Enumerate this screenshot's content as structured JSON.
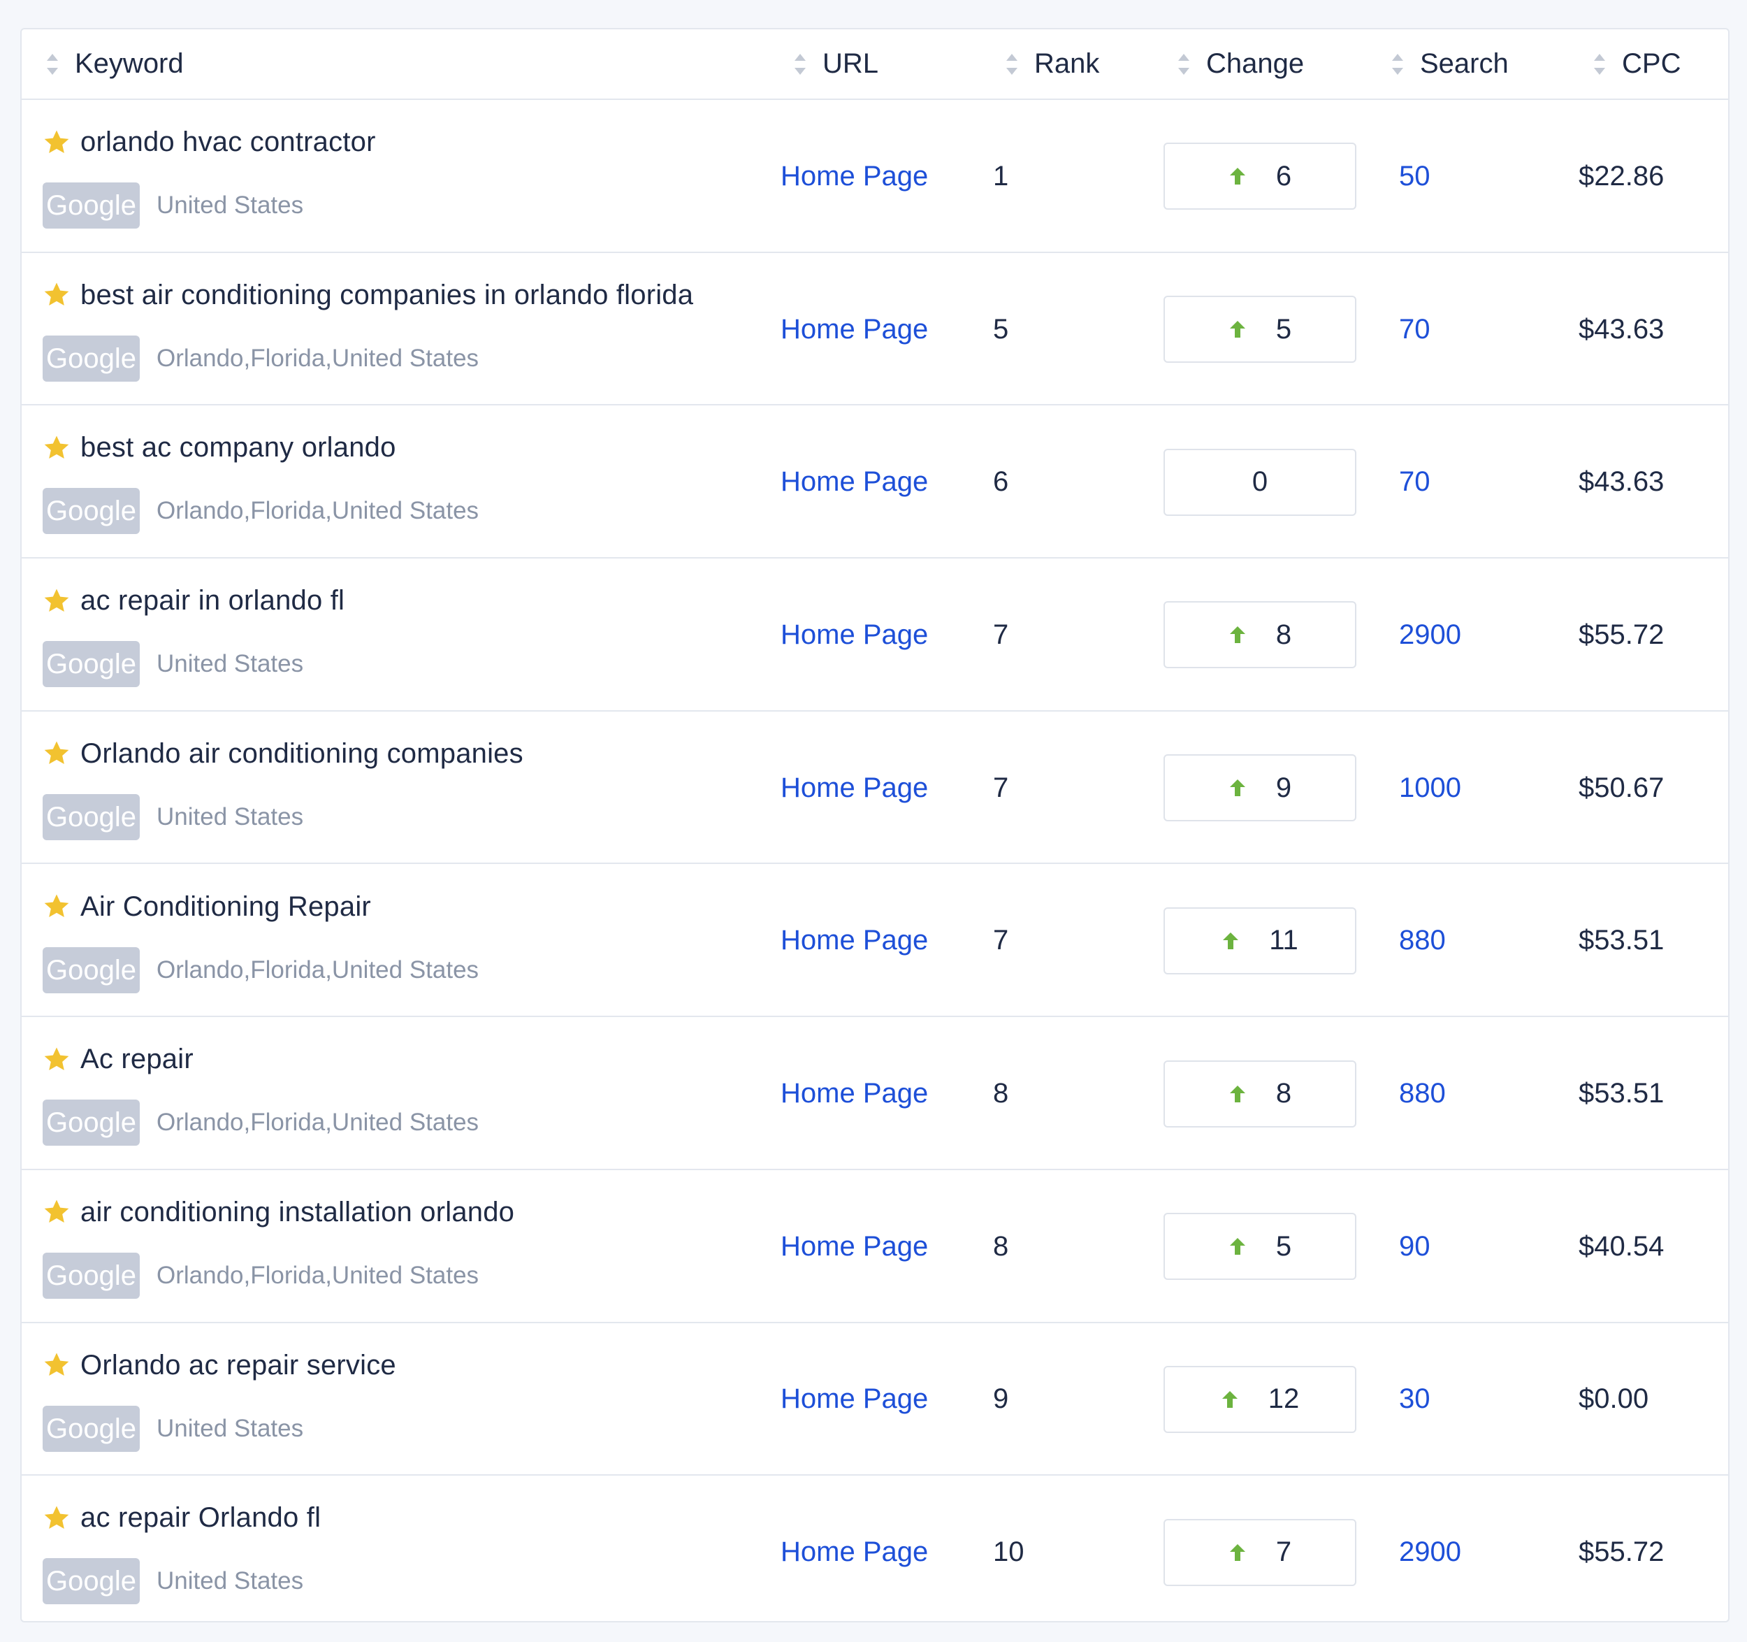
{
  "table": {
    "columns": [
      {
        "key": "keyword",
        "label": "Keyword"
      },
      {
        "key": "url",
        "label": "URL"
      },
      {
        "key": "rank",
        "label": "Rank"
      },
      {
        "key": "change",
        "label": "Change"
      },
      {
        "key": "search",
        "label": "Search"
      },
      {
        "key": "cpc",
        "label": "CPC"
      }
    ],
    "rows": [
      {
        "keyword": "orlando hvac contractor",
        "engine": "Google",
        "location": "United States",
        "url": "Home Page",
        "rank": "1",
        "change": "6",
        "change_dir": "up",
        "search": "50",
        "cpc": "$22.86"
      },
      {
        "keyword": "best air conditioning companies in orlando florida",
        "engine": "Google",
        "location": "Orlando,Florida,United States",
        "url": "Home Page",
        "rank": "5",
        "change": "5",
        "change_dir": "up",
        "search": "70",
        "cpc": "$43.63"
      },
      {
        "keyword": "best ac company orlando",
        "engine": "Google",
        "location": "Orlando,Florida,United States",
        "url": "Home Page",
        "rank": "6",
        "change": "0",
        "change_dir": "none",
        "search": "70",
        "cpc": "$43.63"
      },
      {
        "keyword": "ac repair in orlando fl",
        "engine": "Google",
        "location": "United States",
        "url": "Home Page",
        "rank": "7",
        "change": "8",
        "change_dir": "up",
        "search": "2900",
        "cpc": "$55.72"
      },
      {
        "keyword": "Orlando air conditioning companies",
        "engine": "Google",
        "location": "United States",
        "url": "Home Page",
        "rank": "7",
        "change": "9",
        "change_dir": "up",
        "search": "1000",
        "cpc": "$50.67"
      },
      {
        "keyword": "Air Conditioning Repair",
        "engine": "Google",
        "location": "Orlando,Florida,United States",
        "url": "Home Page",
        "rank": "7",
        "change": "11",
        "change_dir": "up",
        "search": "880",
        "cpc": "$53.51"
      },
      {
        "keyword": "Ac repair",
        "engine": "Google",
        "location": "Orlando,Florida,United States",
        "url": "Home Page",
        "rank": "8",
        "change": "8",
        "change_dir": "up",
        "search": "880",
        "cpc": "$53.51"
      },
      {
        "keyword": "air conditioning installation orlando",
        "engine": "Google",
        "location": "Orlando,Florida,United States",
        "url": "Home Page",
        "rank": "8",
        "change": "5",
        "change_dir": "up",
        "search": "90",
        "cpc": "$40.54"
      },
      {
        "keyword": "Orlando ac repair service",
        "engine": "Google",
        "location": "United States",
        "url": "Home Page",
        "rank": "9",
        "change": "12",
        "change_dir": "up",
        "search": "30",
        "cpc": "$0.00"
      },
      {
        "keyword": "ac repair Orlando fl",
        "engine": "Google",
        "location": "United States",
        "url": "Home Page",
        "rank": "10",
        "change": "7",
        "change_dir": "up",
        "search": "2900",
        "cpc": "$55.72"
      }
    ]
  },
  "icons": {
    "favorite": "star-icon",
    "sort": "sort-icon",
    "change_up": "arrow-up-icon"
  },
  "colors": {
    "link": "#1d4fd8",
    "star": "#f2c230",
    "arrow_up": "#6cb33f",
    "engine_badge": "#c6ccd9",
    "text": "#1f2a44",
    "muted": "#8a94a6"
  }
}
